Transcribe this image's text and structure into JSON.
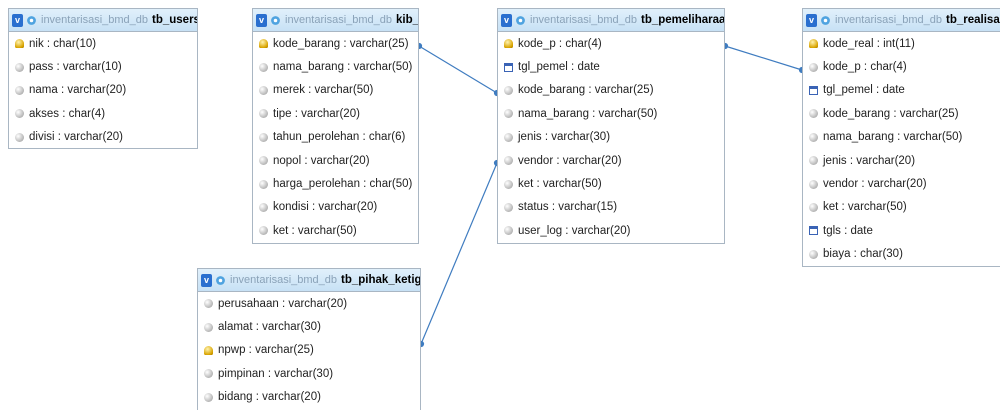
{
  "tables": [
    {
      "db": "inventarisasi_bmd_db",
      "name": "tb_users",
      "fields": [
        {
          "label": "nik : char(10)",
          "type": "key"
        },
        {
          "label": "pass : varchar(10)",
          "type": "col"
        },
        {
          "label": "nama : varchar(20)",
          "type": "col"
        },
        {
          "label": "akses : char(4)",
          "type": "col"
        },
        {
          "label": "divisi : varchar(20)",
          "type": "col"
        }
      ]
    },
    {
      "db": "inventarisasi_bmd_db",
      "name": "kib_b",
      "fields": [
        {
          "label": "kode_barang : varchar(25)",
          "type": "key"
        },
        {
          "label": "nama_barang : varchar(50)",
          "type": "col"
        },
        {
          "label": "merek : varchar(50)",
          "type": "col"
        },
        {
          "label": "tipe : varchar(20)",
          "type": "col"
        },
        {
          "label": "tahun_perolehan : char(6)",
          "type": "col"
        },
        {
          "label": "nopol : varchar(20)",
          "type": "col"
        },
        {
          "label": "harga_perolehan : char(50)",
          "type": "col"
        },
        {
          "label": "kondisi : varchar(20)",
          "type": "col"
        },
        {
          "label": "ket : varchar(50)",
          "type": "col"
        }
      ]
    },
    {
      "db": "inventarisasi_bmd_db",
      "name": "tb_pemeliharaan",
      "fields": [
        {
          "label": "kode_p : char(4)",
          "type": "key"
        },
        {
          "label": "tgl_pemel : date",
          "type": "date"
        },
        {
          "label": "kode_barang : varchar(25)",
          "type": "col"
        },
        {
          "label": "nama_barang : varchar(50)",
          "type": "col"
        },
        {
          "label": "jenis : varchar(30)",
          "type": "col"
        },
        {
          "label": "vendor : varchar(20)",
          "type": "col"
        },
        {
          "label": "ket : varchar(50)",
          "type": "col"
        },
        {
          "label": "status : varchar(15)",
          "type": "col"
        },
        {
          "label": "user_log : varchar(20)",
          "type": "col"
        }
      ]
    },
    {
      "db": "inventarisasi_bmd_db",
      "name": "tb_realisas",
      "fields": [
        {
          "label": "kode_real : int(11)",
          "type": "key"
        },
        {
          "label": "kode_p : char(4)",
          "type": "col"
        },
        {
          "label": "tgl_pemel : date",
          "type": "date"
        },
        {
          "label": "kode_barang : varchar(25)",
          "type": "col"
        },
        {
          "label": "nama_barang : varchar(50)",
          "type": "col"
        },
        {
          "label": "jenis : varchar(20)",
          "type": "col"
        },
        {
          "label": "vendor : varchar(20)",
          "type": "col"
        },
        {
          "label": "ket : varchar(50)",
          "type": "col"
        },
        {
          "label": "tgls : date",
          "type": "date"
        },
        {
          "label": "biaya : char(30)",
          "type": "col"
        }
      ]
    },
    {
      "db": "inventarisasi_bmd_db",
      "name": "tb_pihak_ketiga",
      "fields": [
        {
          "label": "perusahaan : varchar(20)",
          "type": "col"
        },
        {
          "label": "alamat : varchar(30)",
          "type": "col"
        },
        {
          "label": "npwp : varchar(25)",
          "type": "key"
        },
        {
          "label": "pimpinan : varchar(30)",
          "type": "col"
        },
        {
          "label": "bidang : varchar(20)",
          "type": "col"
        }
      ]
    }
  ],
  "colors": {
    "line": "#3f7cc0",
    "header_top": "#e1f0fb",
    "header_bottom": "#c7e1f5",
    "border": "#a9b6c3"
  }
}
